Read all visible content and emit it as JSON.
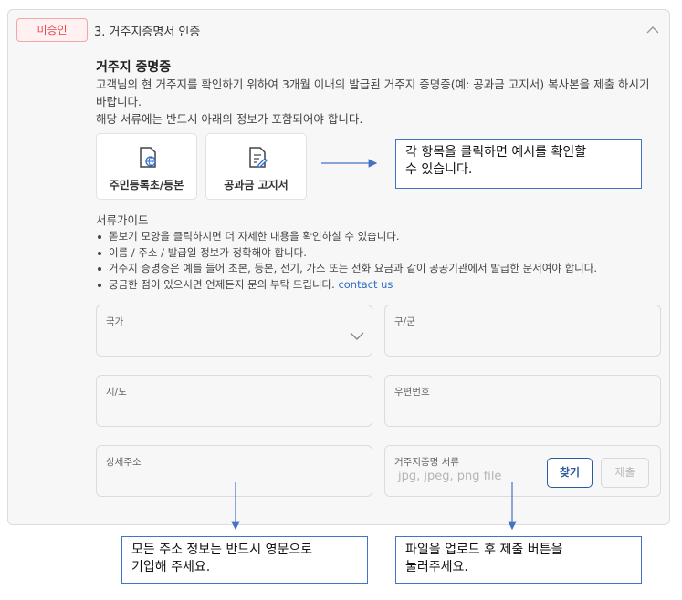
{
  "section": {
    "status_badge": "미승인",
    "title": "3. 거주지증명서 인증"
  },
  "proof": {
    "heading": "거주지 증명증",
    "description_line1": "고객님의 현 거주지를 확인하기 위하여 3개월 이내의 발급된 거주지 증명증(예: 공과금 고지서) 복사본을 제출 하시기",
    "description_line2": "바랍니다.",
    "description_line3": "해당 서류에는 반드시 아래의 정보가 포함되어야 합니다.",
    "documents": [
      {
        "label": "주민등록초/등본",
        "icon": "document-globe-icon"
      },
      {
        "label": "공과금 고지서",
        "icon": "document-edit-icon"
      }
    ]
  },
  "guide": {
    "title": "서류가이드",
    "items": [
      "돋보기 모양을 클릭하시면 더 자세한 내용을 확인하실 수 있습니다.",
      "이름 / 주소 / 발급일 정보가 정확해야 합니다.",
      "거주지 증명증은 예를 들어 초본, 등본, 전기, 가스 또는 전화 요금과 같이 공공기관에서 발급한 문서여야 합니다."
    ],
    "last_item_text": "궁금한 점이 있으시면 언제든지 문의 부탁 드립니다.",
    "contact_link": "contact us"
  },
  "form": {
    "country_label": "국가",
    "district_label": "구/군",
    "city_label": "시/도",
    "postal_label": "우편번호",
    "address_label": "상세주소",
    "file_label": "거주지증명 서류",
    "file_placeholder": "jpg, jpeg, png file",
    "find_button": "찾기",
    "submit_button": "제출"
  },
  "annotations": {
    "top_line1": "각 항목을 클릭하면 예시를 확인할",
    "top_line2": "수 있습니다.",
    "bottom_left_line1": "모든 주소 정보는 반드시 영문으로",
    "bottom_left_line2": "기입해 주세요.",
    "bottom_right_line1": "파일을 업로드 후 제출 버튼을",
    "bottom_right_line2": "눌러주세요."
  },
  "colors": {
    "badge_text": "#e0494d",
    "link": "#2e6bc6",
    "find_button": "#2d5a9c",
    "annotation_border": "#4472c4"
  }
}
